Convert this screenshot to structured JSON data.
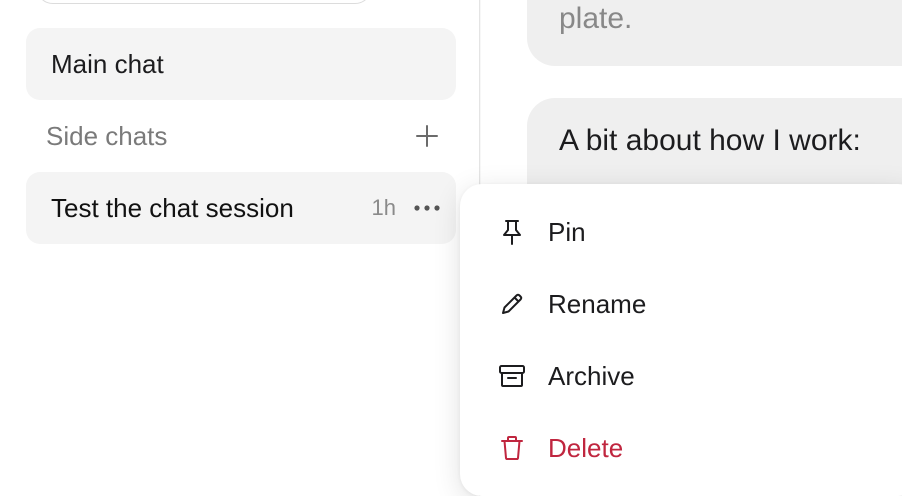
{
  "sidebar": {
    "main_chat_label": "Main chat",
    "side_chats_label": "Side chats",
    "chats": [
      {
        "title": "Test the chat session",
        "time": "1h"
      }
    ]
  },
  "chat": {
    "bubble_top_text": "plate.",
    "bubble_mid_text": "A bit about how I work:"
  },
  "context_menu": {
    "items": [
      {
        "label": "Pin",
        "icon": "pin-icon"
      },
      {
        "label": "Rename",
        "icon": "pencil-icon"
      },
      {
        "label": "Archive",
        "icon": "archive-icon"
      },
      {
        "label": "Delete",
        "icon": "trash-icon"
      }
    ],
    "danger_color": "#c0263f"
  }
}
